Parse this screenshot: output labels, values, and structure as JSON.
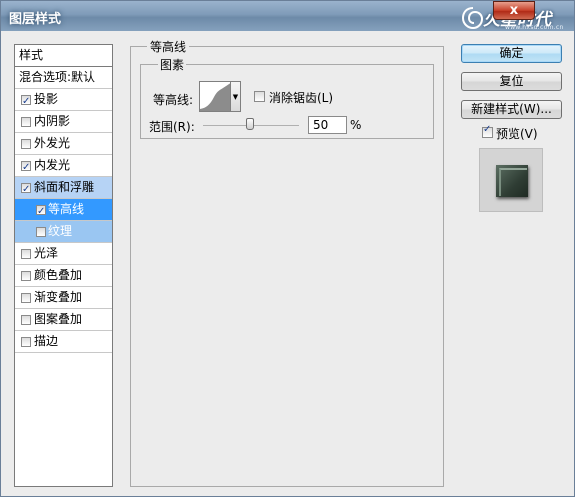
{
  "window": {
    "title": "图层样式",
    "close_label": "x"
  },
  "brand": {
    "logo_text": "火星时代",
    "logo_sub": "www.hxsd.com.cn"
  },
  "left_panel": {
    "header": "样式",
    "blend_options": "混合选项:默认",
    "items": [
      {
        "label": "投影",
        "checked": true
      },
      {
        "label": "内阴影",
        "checked": false
      },
      {
        "label": "外发光",
        "checked": false
      },
      {
        "label": "内发光",
        "checked": true
      },
      {
        "label": "斜面和浮雕",
        "checked": true
      },
      {
        "label": "等高线",
        "checked": true
      },
      {
        "label": "纹理",
        "checked": false
      },
      {
        "label": "光泽",
        "checked": false
      },
      {
        "label": "颜色叠加",
        "checked": false
      },
      {
        "label": "渐变叠加",
        "checked": false
      },
      {
        "label": "图案叠加",
        "checked": false
      },
      {
        "label": "描边",
        "checked": false
      }
    ]
  },
  "contour_panel": {
    "group_title": "等高线",
    "subgroup_title": "图素",
    "contour_label": "等高线:",
    "antialias_label": "消除锯齿(L)",
    "antialias_checked": false,
    "range_label": "范围(R):",
    "range_value": "50",
    "range_unit": "%",
    "range_fraction": 0.5
  },
  "buttons": {
    "ok": "确定",
    "reset": "复位",
    "new_style": "新建样式(W)...",
    "preview_label": "预览(V)",
    "preview_checked": true
  },
  "colors": {
    "selection": "#3399ff",
    "selection_light": "#b6d3f5"
  }
}
